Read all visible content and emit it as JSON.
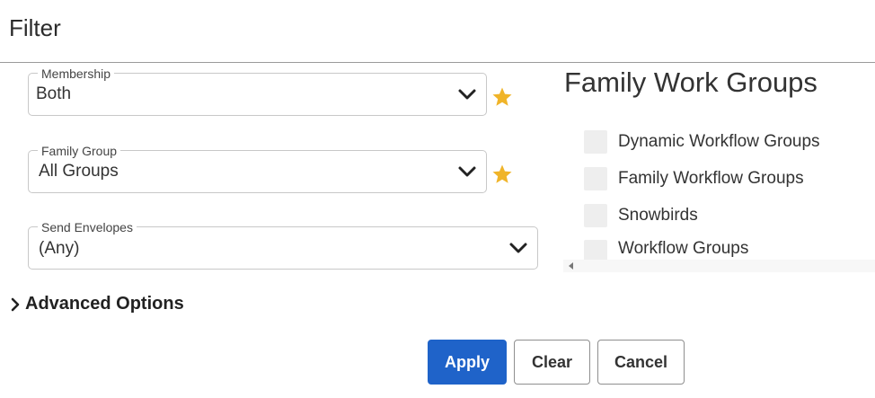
{
  "header": {
    "title": "Filter"
  },
  "fields": [
    {
      "label": "Membership",
      "value": "Both",
      "favorite": true
    },
    {
      "label": "Family Group",
      "value": "All Groups",
      "favorite": true
    },
    {
      "label": "Send Envelopes",
      "value": "(Any)",
      "favorite": false
    }
  ],
  "panel": {
    "title": "Family Work Groups",
    "options": [
      {
        "label": "Dynamic Workflow Groups",
        "checked": false
      },
      {
        "label": "Family Workflow Groups",
        "checked": false
      },
      {
        "label": "Snowbirds",
        "checked": false
      },
      {
        "label": "Workflow Groups",
        "checked": false
      }
    ]
  },
  "advanced": {
    "label": "Advanced Options"
  },
  "buttons": {
    "apply": "Apply",
    "clear": "Clear",
    "cancel": "Cancel"
  },
  "colors": {
    "accent": "#1f63c9",
    "star": "#f0b429"
  }
}
